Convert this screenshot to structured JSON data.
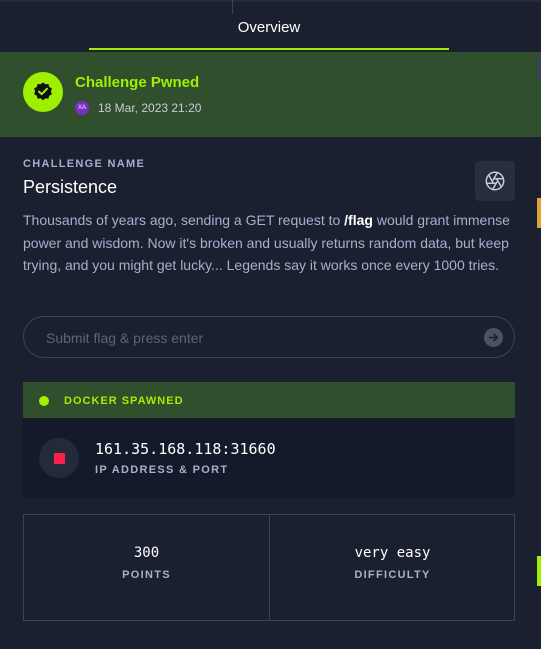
{
  "tabs": {
    "active_label": "Overview"
  },
  "pwned": {
    "title": "Challenge Pwned",
    "date": "18 Mar, 2023 21:20",
    "avatar_initials": "XA"
  },
  "challenge": {
    "section_label": "CHALLENGE NAME",
    "name": "Persistence",
    "description_before": "Thousands of years ago, sending a GET request to ",
    "description_bold": "/flag",
    "description_after": " would grant immense power and wisdom. Now it's broken and usually returns random data, but keep trying, and you might get lucky... Legends say it works once every 1000 tries.",
    "icon": "aperture-icon"
  },
  "flag_input": {
    "placeholder": "Submit flag & press enter",
    "value": ""
  },
  "docker": {
    "status": "DOCKER SPAWNED",
    "ip_port": "161.35.168.118:31660",
    "ip_label": "IP ADDRESS & PORT"
  },
  "stats": {
    "points_value": "300",
    "points_label": "POINTS",
    "difficulty_value": "very easy",
    "difficulty_label": "DIFFICULTY"
  },
  "colors": {
    "accent": "#9fef00",
    "stop": "#ff1f4c",
    "background": "#1a2030",
    "banner": "#304f2d"
  }
}
